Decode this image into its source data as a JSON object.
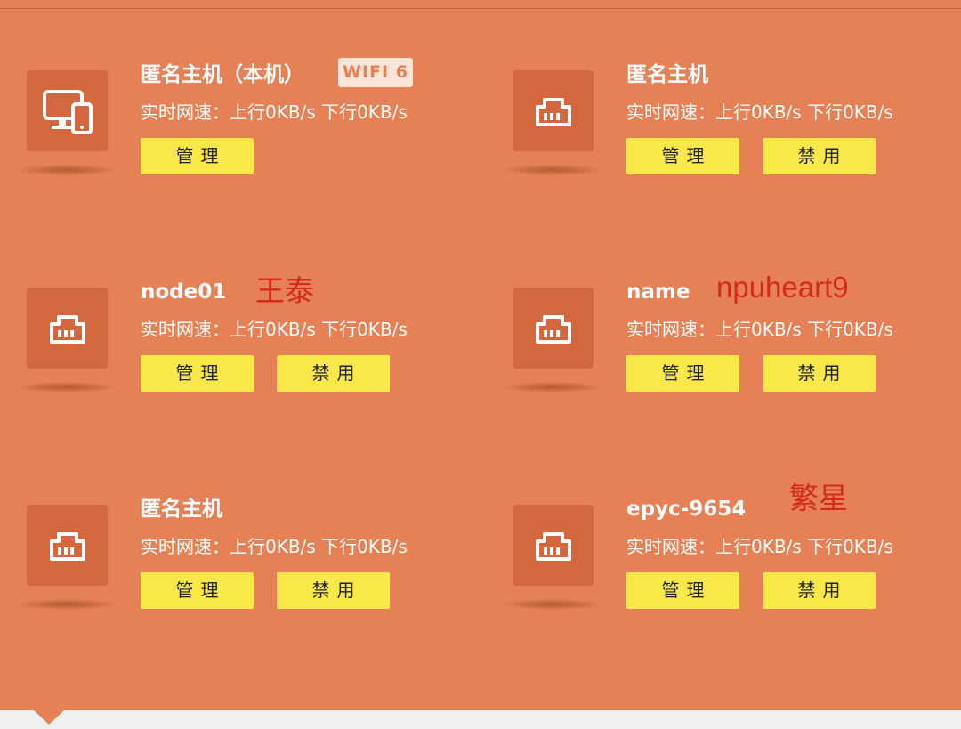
{
  "devices": [
    {
      "name": "匿名主机（本机）",
      "badge": "WIFI 6",
      "icon": "pc-phone-icon",
      "speed": "实时网速：上行0KB/s 下行0KB/s",
      "manage_label": "管理",
      "disable_label": ""
    },
    {
      "name": "匿名主机",
      "icon": "ethernet-icon",
      "speed": "实时网速：上行0KB/s 下行0KB/s",
      "manage_label": "管理",
      "disable_label": "禁用"
    },
    {
      "name": "node01",
      "icon": "ethernet-icon",
      "speed": "实时网速：上行0KB/s 下行0KB/s",
      "manage_label": "管理",
      "disable_label": "禁用"
    },
    {
      "name": "name",
      "icon": "ethernet-icon",
      "speed": "实时网速：上行0KB/s 下行0KB/s",
      "manage_label": "管理",
      "disable_label": "禁用"
    },
    {
      "name": "匿名主机",
      "icon": "ethernet-icon",
      "speed": "实时网速：上行0KB/s 下行0KB/s",
      "manage_label": "管理",
      "disable_label": "禁用"
    },
    {
      "name": "epyc-9654",
      "icon": "ethernet-icon",
      "speed": "实时网速：上行0KB/s 下行0KB/s",
      "manage_label": "管理",
      "disable_label": "禁用"
    }
  ],
  "annotations": [
    "王泰",
    "npuheart9",
    "繁星"
  ],
  "colors": {
    "background": "#e68155",
    "tile": "#d3683f",
    "button": "#f9e84a",
    "annotation": "#d42a1e"
  }
}
